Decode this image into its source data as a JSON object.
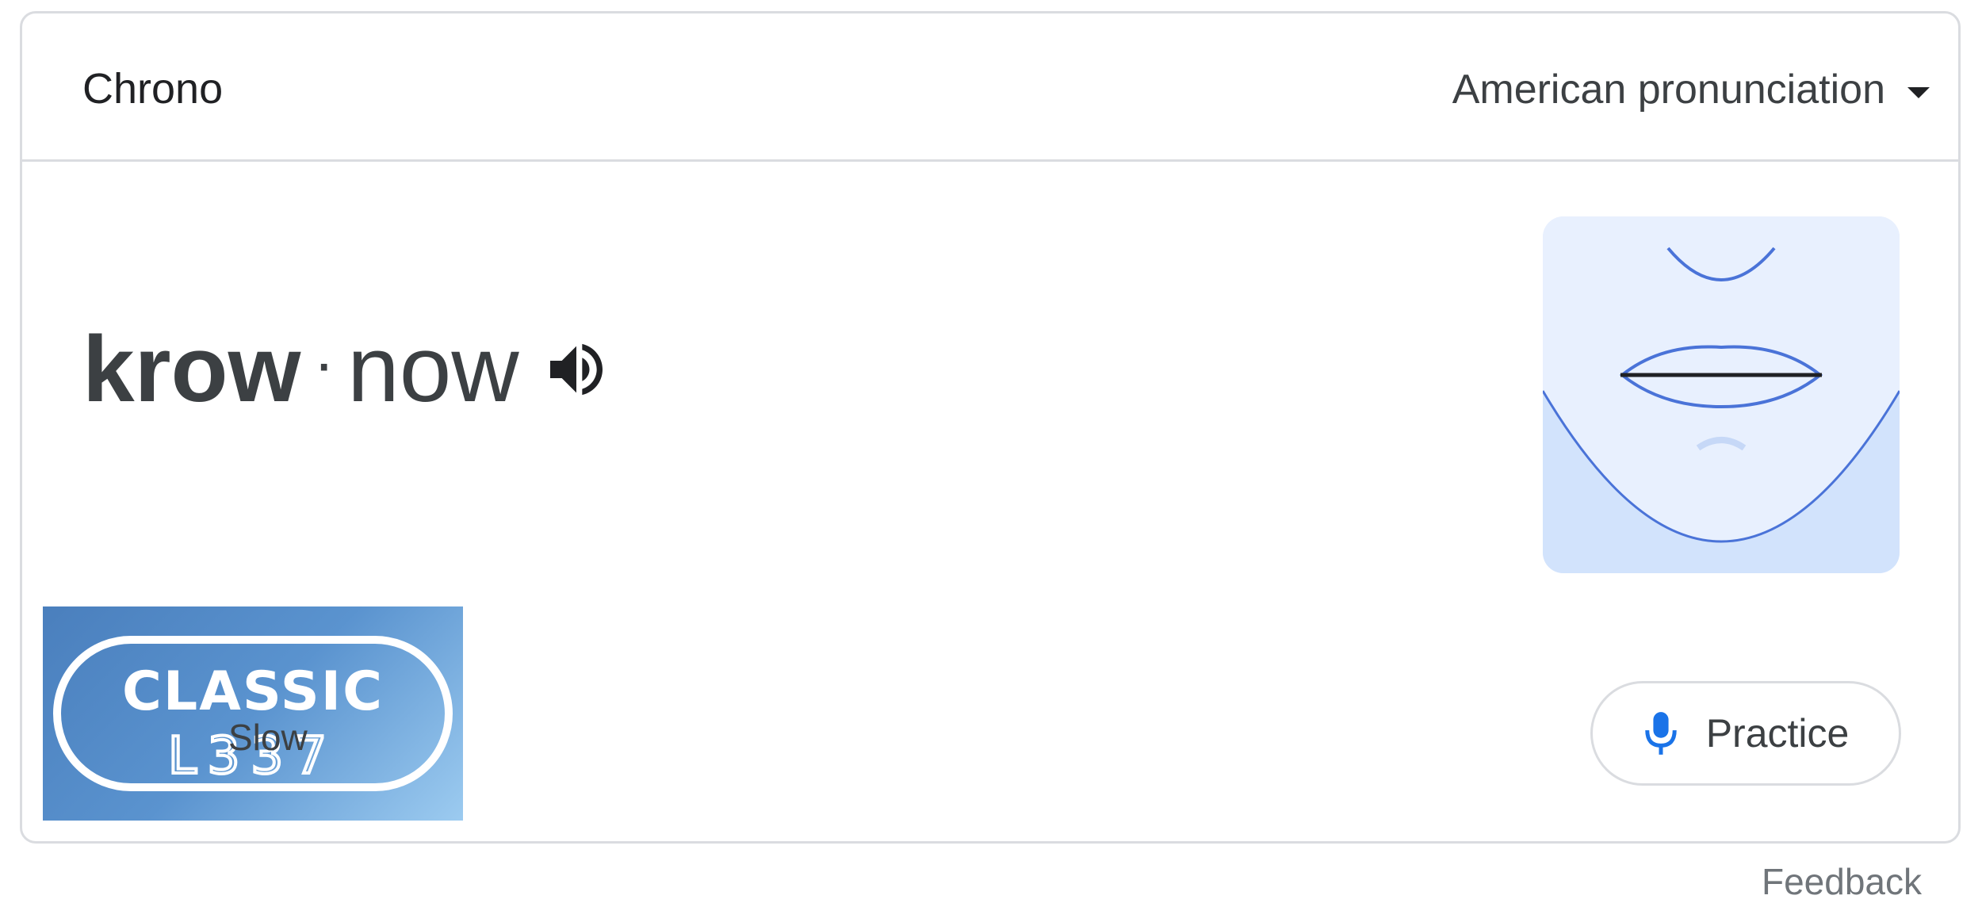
{
  "header": {
    "title": "Chrono",
    "accent_dropdown_label": "American pronunciation"
  },
  "pronunciation": {
    "syllable_stressed": "krow",
    "separator": "·",
    "syllable_unstressed": "now"
  },
  "slow_button": {
    "label": "Slow",
    "watermark_text": "CLASSIC L337"
  },
  "practice_button": {
    "label": "Practice"
  },
  "footer": {
    "feedback_label": "Feedback"
  },
  "colors": {
    "border": "#dadce0",
    "mouth_bg": "#e8f0fe",
    "mouth_lines": "#4a73d8",
    "mic_blue": "#1a73e8"
  },
  "icons": {
    "dropdown": "caret-down-icon",
    "audio": "speaker-icon",
    "mic": "microphone-icon"
  }
}
